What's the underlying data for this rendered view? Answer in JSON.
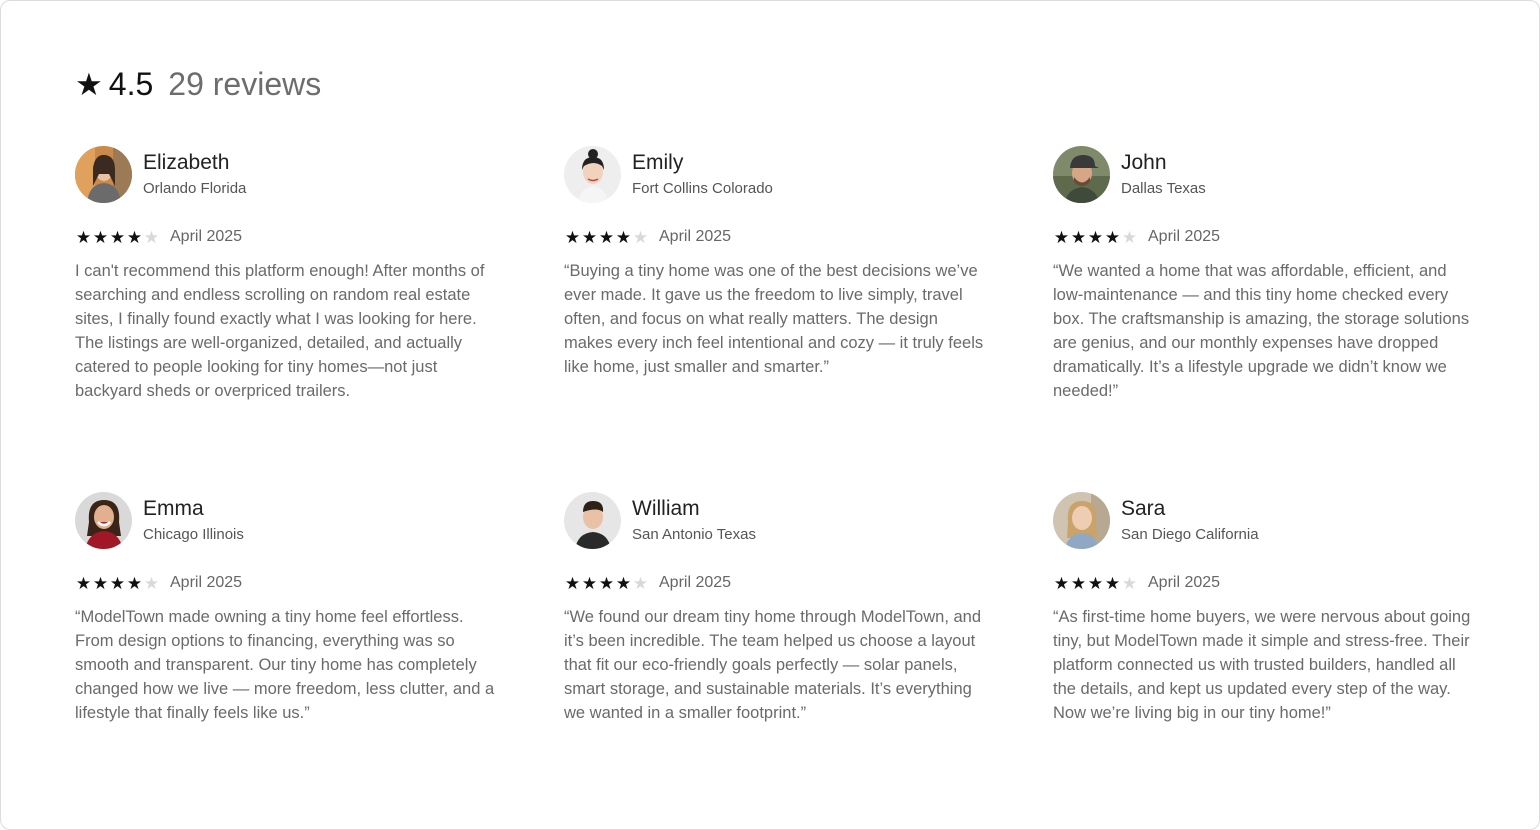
{
  "summary": {
    "star_icon": "star-icon",
    "rating": "4.5",
    "count_label": "29 reviews"
  },
  "reviews": [
    {
      "name": "Elizabeth",
      "location": "Orlando Florida",
      "date": "April 2025",
      "stars": 4,
      "max_stars": 5,
      "text": "I can't recommend this platform enough! After months of searching and endless scrolling on random real estate sites, I finally found exactly what I was looking for here. The listings are well-organized, detailed, and actually catered to people looking for tiny homes—not just backyard sheds or overpriced trailers."
    },
    {
      "name": "Emily",
      "location": "Fort Collins Colorado",
      "date": "April 2025",
      "stars": 4,
      "max_stars": 5,
      "text": "“Buying a tiny home was one of the best decisions we’ve ever made. It gave us the freedom to live simply, travel often, and focus on what really matters. The design makes every inch feel intentional and cozy — it truly feels like home, just smaller and smarter.”"
    },
    {
      "name": "John",
      "location": "Dallas Texas",
      "date": "April 2025",
      "stars": 4,
      "max_stars": 5,
      "text": "“We wanted a home that was affordable, efficient, and low-maintenance — and this tiny home checked every box. The craftsmanship is amazing, the storage solutions are genius, and our monthly expenses have dropped dramatically. It’s a lifestyle upgrade we didn’t know we needed!”"
    },
    {
      "name": "Emma",
      "location": "Chicago Illinois",
      "date": "April 2025",
      "stars": 4,
      "max_stars": 5,
      "text": "“ModelTown made owning a tiny home feel effortless. From design options to financing, everything was so smooth and transparent. Our tiny home has completely changed how we live — more freedom, less clutter, and a lifestyle that finally feels like us.”"
    },
    {
      "name": "William",
      "location": "San Antonio Texas",
      "date": "April 2025",
      "stars": 4,
      "max_stars": 5,
      "text": "“We found our dream tiny home through ModelTown, and it’s been incredible. The team helped us choose a layout that fit our eco-friendly goals perfectly — solar panels, smart storage, and sustainable materials. It’s everything we wanted in a smaller footprint.”"
    },
    {
      "name": "Sara",
      "location": "San Diego California",
      "date": "April 2025",
      "stars": 4,
      "max_stars": 5,
      "text": "“As first-time home buyers, we were nervous about going tiny, but ModelTown made it simple and stress-free. Their platform connected us with trusted builders, handled all the details, and kept us updated every step of the way. Now we’re living big in our tiny home!”"
    }
  ]
}
